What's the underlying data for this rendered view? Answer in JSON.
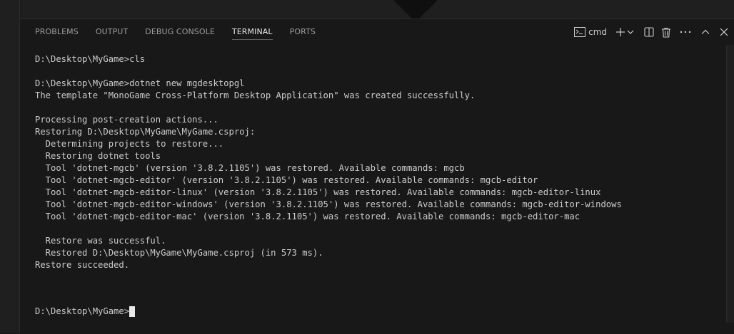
{
  "panel": {
    "tabs": [
      {
        "label": "PROBLEMS"
      },
      {
        "label": "OUTPUT"
      },
      {
        "label": "DEBUG CONSOLE"
      },
      {
        "label": "TERMINAL",
        "active": true
      },
      {
        "label": "PORTS"
      }
    ],
    "actions": {
      "shell_label": "cmd",
      "icons": [
        "terminal-icon",
        "plus-icon",
        "chevron-down-icon",
        "split-icon",
        "trash-icon",
        "more-icon",
        "chevron-up-icon",
        "close-icon"
      ]
    }
  },
  "terminal": {
    "lines": [
      "D:\\Desktop\\MyGame>cls",
      "",
      "D:\\Desktop\\MyGame>dotnet new mgdesktopgl",
      "The template \"MonoGame Cross-Platform Desktop Application\" was created successfully.",
      "",
      "Processing post-creation actions...",
      "Restoring D:\\Desktop\\MyGame\\MyGame.csproj:",
      "  Determining projects to restore...",
      "  Restoring dotnet tools",
      "  Tool 'dotnet-mgcb' (version '3.8.2.1105') was restored. Available commands: mgcb",
      "  Tool 'dotnet-mgcb-editor' (version '3.8.2.1105') was restored. Available commands: mgcb-editor",
      "  Tool 'dotnet-mgcb-editor-linux' (version '3.8.2.1105') was restored. Available commands: mgcb-editor-linux",
      "  Tool 'dotnet-mgcb-editor-windows' (version '3.8.2.1105') was restored. Available commands: mgcb-editor-windows",
      "  Tool 'dotnet-mgcb-editor-mac' (version '3.8.2.1105') was restored. Available commands: mgcb-editor-mac",
      "",
      "  Restore was successful.",
      "  Restored D:\\Desktop\\MyGame\\MyGame.csproj (in 573 ms).",
      "Restore succeeded."
    ],
    "prompt": "D:\\Desktop\\MyGame>"
  },
  "colors": {
    "background": "#181818",
    "text": "#cccccc",
    "accent": "#0078d4"
  }
}
